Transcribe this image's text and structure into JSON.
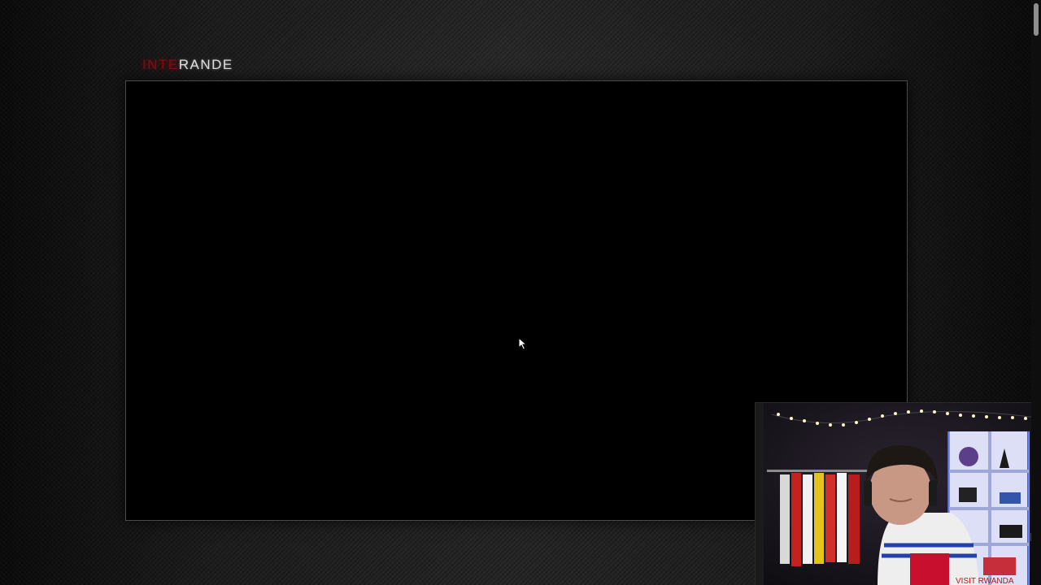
{
  "site": {
    "logo_part_a": "INTE",
    "logo_part_b": "RANDE"
  },
  "icons": {
    "cursor": "mouse-pointer-icon"
  },
  "webcam": {
    "shirt_text": "VISIT RWANDA"
  },
  "colors": {
    "logo_red": "#8a0b10",
    "logo_light": "#e2e2e2",
    "game_background": "#000000",
    "page_background": "#1d1d1d"
  }
}
